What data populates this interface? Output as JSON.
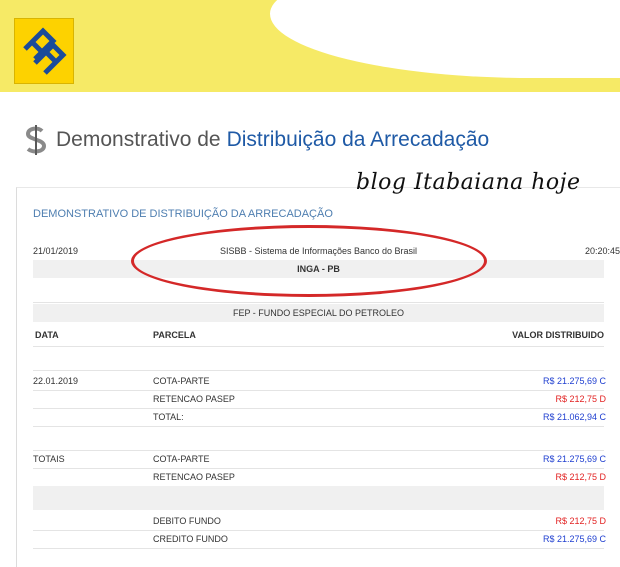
{
  "header": {
    "heading_prefix": "Demonstrativo de",
    "heading_main": "Distribuição da Arrecadação"
  },
  "watermark": "blog Itabaiana hoje",
  "report": {
    "title": "DEMONSTRATIVO DE DISTRIBUIÇÃO DA ARRECADAÇÃO",
    "date": "21/01/2019",
    "system": "SISBB - Sistema de Informações Banco do Brasil",
    "time": "20:20:45",
    "municipality": "INGA - PB",
    "fund": "FEP - FUNDO ESPECIAL DO PETROLEO",
    "columns": {
      "data": "DATA",
      "parcela": "PARCELA",
      "valor": "VALOR DISTRIBUIDO"
    },
    "entries": [
      {
        "data": "22.01.2019",
        "parcela": "COTA-PARTE",
        "valor": "R$ 21.275,69 C",
        "type": "credit"
      },
      {
        "data": "",
        "parcela": "RETENCAO PASEP",
        "valor": "R$ 212,75 D",
        "type": "debit"
      },
      {
        "data": "",
        "parcela": "TOTAL:",
        "valor": "R$ 21.062,94 C",
        "type": "credit"
      }
    ],
    "totals_label": "TOTAIS",
    "totals": [
      {
        "parcela": "COTA-PARTE",
        "valor": "R$ 21.275,69 C",
        "type": "credit"
      },
      {
        "parcela": "RETENCAO PASEP",
        "valor": "R$ 212,75 D",
        "type": "debit"
      }
    ],
    "fund_movements": [
      {
        "parcela": "DEBITO FUNDO",
        "valor": "R$ 212,75 D",
        "type": "debit"
      },
      {
        "parcela": "CREDITO FUNDO",
        "valor": "R$ 21.275,69 C",
        "type": "credit"
      }
    ]
  },
  "colors": {
    "banner": "#f6ea66",
    "title_blue": "#1f5aa6",
    "credit_blue": "#1f3fd0",
    "debit_red": "#e22222",
    "highlight_oval": "#d42828"
  }
}
